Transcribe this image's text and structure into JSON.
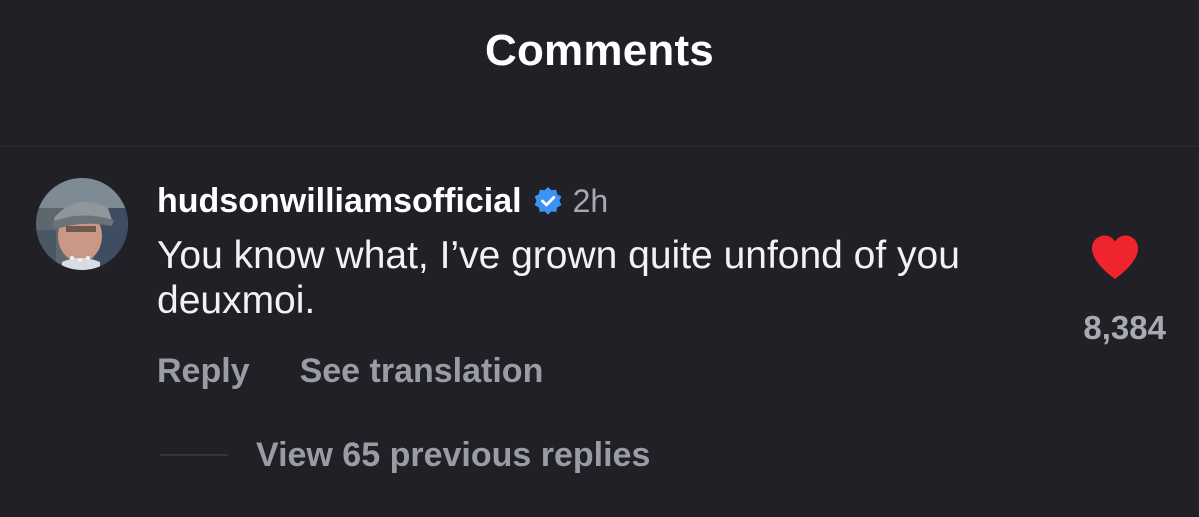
{
  "header": {
    "title": "Comments"
  },
  "comment": {
    "username": "hudsonwilliamsofficial",
    "verified": true,
    "verified_icon": "verified-badge-icon",
    "timestamp": "2h",
    "text": "You know what, I’ve grown quite unfond of you deuxmoi.",
    "like_icon": "heart-filled-icon",
    "liked": true,
    "like_count": "8,384",
    "actions": {
      "reply_label": "Reply",
      "translate_label": "See translation"
    },
    "replies": {
      "label": "View 65 previous replies"
    }
  },
  "colors": {
    "background": "#202026",
    "heart": "#f0242f",
    "verified": "#3b93f5",
    "muted_text": "#9a9ca4"
  }
}
